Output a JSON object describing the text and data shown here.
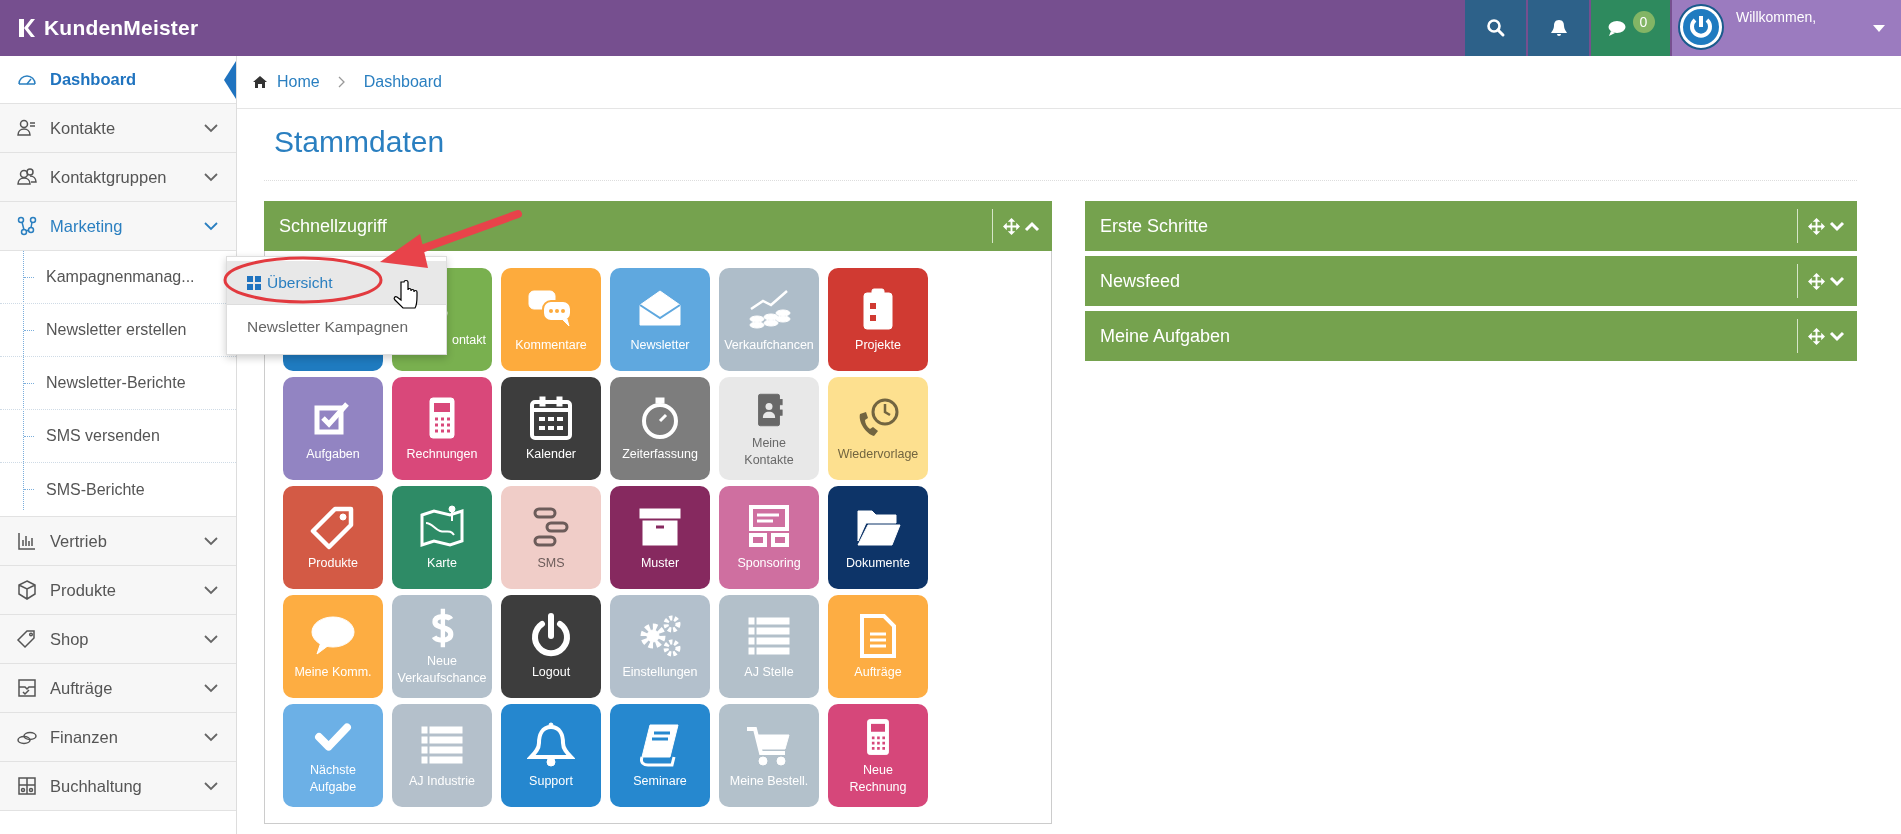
{
  "header": {
    "logo": "KundenMeister",
    "messages_badge": "0",
    "welcome": "Willkommen,"
  },
  "sidebar": {
    "items": [
      {
        "label": "Dashboard",
        "selected": true
      },
      {
        "label": "Kontakte",
        "selected": false,
        "expanded": false
      },
      {
        "label": "Kontaktgruppen",
        "selected": false,
        "expanded": false
      },
      {
        "label": "Marketing",
        "selected": false,
        "expanded": true,
        "children": [
          {
            "label": "Kampagnenmanag...",
            "selected": false
          },
          {
            "label": "Newsletter erstellen",
            "selected": false
          },
          {
            "label": "Newsletter-Berichte",
            "selected": false
          },
          {
            "label": "SMS versenden",
            "selected": false
          },
          {
            "label": "SMS-Berichte",
            "selected": false
          }
        ]
      },
      {
        "label": "Vertrieb",
        "selected": false,
        "expanded": false
      },
      {
        "label": "Produkte",
        "selected": false,
        "expanded": false
      },
      {
        "label": "Shop",
        "selected": false,
        "expanded": false
      },
      {
        "label": "Aufträge",
        "selected": false,
        "expanded": false
      },
      {
        "label": "Finanzen",
        "selected": false,
        "expanded": false
      },
      {
        "label": "Buchhaltung",
        "selected": false,
        "expanded": false
      }
    ]
  },
  "flyout": {
    "items": [
      {
        "label": "Übersicht",
        "selected": true
      },
      {
        "label": "Newsletter Kampagnen",
        "selected": false
      }
    ]
  },
  "breadcrumb": [
    "Home",
    "Dashboard"
  ],
  "page_title": "Stammdaten",
  "left_panels": [
    {
      "title": "Schnellzugriff",
      "expanded": true,
      "tiles": [
        {
          "kind": "covered",
          "color": "#1f7bc0"
        },
        {
          "kind": "covered",
          "label": "ontakt",
          "color": "#79b04f"
        },
        {
          "kind": "tile",
          "label": "Kommentare",
          "color": "#fdab3d"
        },
        {
          "kind": "tile",
          "label": "Newsletter",
          "color": "#5fa8df"
        },
        {
          "kind": "tile",
          "label": "Verkaufchancen",
          "color": "#aebdc9"
        },
        {
          "kind": "tile",
          "label": "Projekte",
          "color": "#d03a32"
        },
        {
          "kind": "tile",
          "label": "Aufgaben",
          "color": "#9284c2"
        },
        {
          "kind": "tile",
          "label": "Rechnungen",
          "color": "#d9487a"
        },
        {
          "kind": "tile",
          "label": "Kalender",
          "color": "#3d3d3d"
        },
        {
          "kind": "tile",
          "label": "Zeiterfassung",
          "color": "#7d7d7d"
        },
        {
          "kind": "tile",
          "label": "Meine\nKontakte",
          "color": "#e8e8e8"
        },
        {
          "kind": "tile",
          "label": "Wiedervorlage",
          "color": "#fde08f"
        },
        {
          "kind": "tile",
          "label": "Produkte",
          "color": "#d35a45"
        },
        {
          "kind": "tile",
          "label": "Karte",
          "color": "#2e8b66"
        },
        {
          "kind": "tile",
          "label": "SMS",
          "color": "#f0cdc8"
        },
        {
          "kind": "tile",
          "label": "Muster",
          "color": "#86295f"
        },
        {
          "kind": "tile",
          "label": "Sponsoring",
          "color": "#cf6fa0"
        },
        {
          "kind": "tile",
          "label": "Dokumente",
          "color": "#0d3468"
        },
        {
          "kind": "tile",
          "label": "Meine Komm.",
          "color": "#fdad42"
        },
        {
          "kind": "tile",
          "label": "Neue\nVerkaufschance",
          "color": "#b3c0cb"
        },
        {
          "kind": "tile",
          "label": "Logout",
          "color": "#3d3d3d"
        },
        {
          "kind": "tile",
          "label": "Einstellungen",
          "color": "#b3c0cc"
        },
        {
          "kind": "tile",
          "label": "AJ Stelle",
          "color": "#b3c0ca"
        },
        {
          "kind": "tile",
          "label": "Aufträge",
          "color": "#fdad43"
        },
        {
          "kind": "tile",
          "label": "Nächste\nAufgabe",
          "color": "#6cb0e6"
        },
        {
          "kind": "tile",
          "label": "AJ Industrie",
          "color": "#b4c0cb"
        },
        {
          "kind": "tile",
          "label": "Support",
          "color": "#2587cf"
        },
        {
          "kind": "tile",
          "label": "Seminare",
          "color": "#2688cf"
        },
        {
          "kind": "tile",
          "label": "Meine Bestell.",
          "color": "#b3c1cb"
        },
        {
          "kind": "tile",
          "label": "Neue\nRechnung",
          "color": "#d6477a"
        }
      ]
    }
  ],
  "right_panels": [
    {
      "title": "Erste Schritte",
      "expanded": false
    },
    {
      "title": "Newsfeed",
      "expanded": false
    },
    {
      "title": "Meine Aufgaben",
      "expanded": false
    }
  ]
}
